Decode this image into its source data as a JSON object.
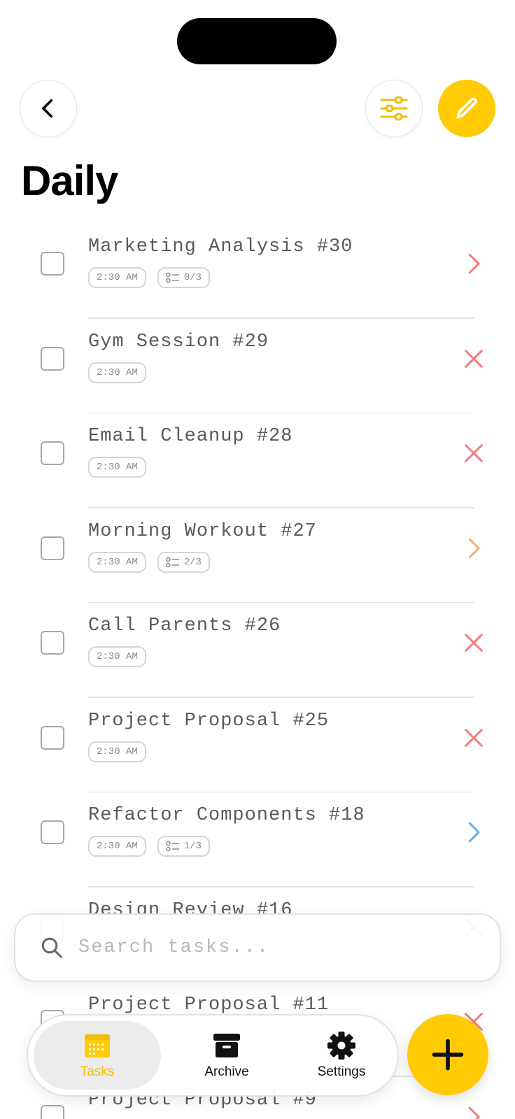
{
  "header": {
    "title": "Daily"
  },
  "colors": {
    "accent": "#FFCB05",
    "red_action": "#F08080",
    "orange_action": "#F4B177",
    "blue_action": "#6DB2E8"
  },
  "tasks": [
    {
      "title": "Marketing Analysis #30",
      "time": "2:30 AM",
      "subtasks": "0/3",
      "action_icon": "chevron-right-icon",
      "action_color": "#F08080"
    },
    {
      "title": "Gym Session #29",
      "time": "2:30 AM",
      "subtasks": "",
      "action_icon": "close-icon",
      "action_color": "#F08080"
    },
    {
      "title": "Email Cleanup #28",
      "time": "2:30 AM",
      "subtasks": "",
      "action_icon": "close-icon",
      "action_color": "#F08080"
    },
    {
      "title": "Morning Workout #27",
      "time": "2:30 AM",
      "subtasks": "2/3",
      "action_icon": "chevron-right-icon",
      "action_color": "#F4B177"
    },
    {
      "title": "Call Parents #26",
      "time": "2:30 AM",
      "subtasks": "",
      "action_icon": "close-icon",
      "action_color": "#F08080"
    },
    {
      "title": "Project Proposal #25",
      "time": "2:30 AM",
      "subtasks": "",
      "action_icon": "close-icon",
      "action_color": "#F08080"
    },
    {
      "title": "Refactor Components #18",
      "time": "2:30 AM",
      "subtasks": "1/3",
      "action_icon": "chevron-right-icon",
      "action_color": "#6DB2E8"
    },
    {
      "title": "Design Review #16",
      "time": "",
      "subtasks": "",
      "action_icon": "close-icon",
      "action_color": "#F08080"
    },
    {
      "title": "Project Proposal #11",
      "time": "",
      "subtasks": "",
      "action_icon": "close-icon",
      "action_color": "#F08080"
    },
    {
      "title": "Project Proposal #9",
      "time": "",
      "subtasks": "",
      "action_icon": "chevron-right-icon",
      "action_color": "#F08080"
    }
  ],
  "search": {
    "placeholder": "Search tasks..."
  },
  "tabs": {
    "tasks_label": "Tasks",
    "archive_label": "Archive",
    "settings_label": "Settings"
  }
}
